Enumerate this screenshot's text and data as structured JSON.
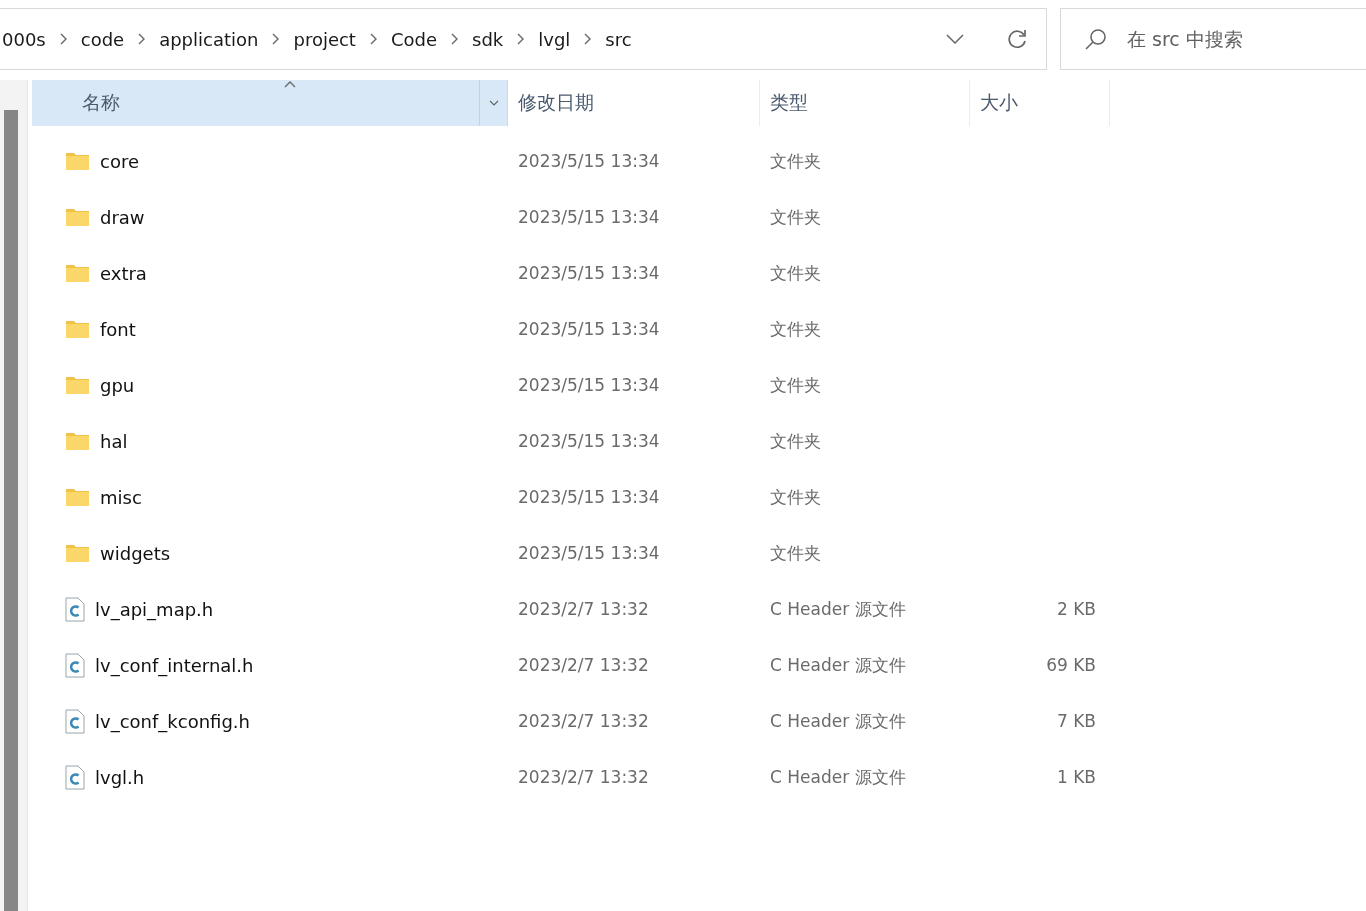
{
  "address_bar": {
    "path": [
      "000s",
      "code",
      "application",
      "project",
      "Code",
      "sdk",
      "lvgl",
      "src"
    ]
  },
  "search": {
    "placeholder": "在 src 中搜索"
  },
  "columns": [
    {
      "label": "名称",
      "selected": true
    },
    {
      "label": "修改日期",
      "selected": false
    },
    {
      "label": "类型",
      "selected": false
    },
    {
      "label": "大小",
      "selected": false
    }
  ],
  "files": [
    {
      "kind": "folder",
      "name": "core",
      "modified": "2023/5/15 13:34",
      "type": "文件夹"
    },
    {
      "kind": "folder",
      "name": "draw",
      "modified": "2023/5/15 13:34",
      "type": "文件夹"
    },
    {
      "kind": "folder",
      "name": "extra",
      "modified": "2023/5/15 13:34",
      "type": "文件夹"
    },
    {
      "kind": "folder",
      "name": "font",
      "modified": "2023/5/15 13:34",
      "type": "文件夹"
    },
    {
      "kind": "folder",
      "name": "gpu",
      "modified": "2023/5/15 13:34",
      "type": "文件夹"
    },
    {
      "kind": "folder",
      "name": "hal",
      "modified": "2023/5/15 13:34",
      "type": "文件夹"
    },
    {
      "kind": "folder",
      "name": "misc",
      "modified": "2023/5/15 13:34",
      "type": "文件夹"
    },
    {
      "kind": "folder",
      "name": "widgets",
      "modified": "2023/5/15 13:34",
      "type": "文件夹"
    },
    {
      "kind": "file",
      "name": "lv_api_map.h",
      "modified": "2023/2/7 13:32",
      "type": "C Header 源文件",
      "size": "2 KB"
    },
    {
      "kind": "file",
      "name": "lv_conf_internal.h",
      "modified": "2023/2/7 13:32",
      "type": "C Header 源文件",
      "size": "69 KB"
    },
    {
      "kind": "file",
      "name": "lv_conf_kconfig.h",
      "modified": "2023/2/7 13:32",
      "type": "C Header 源文件",
      "size": "7 KB"
    },
    {
      "kind": "file",
      "name": "lvgl.h",
      "modified": "2023/2/7 13:32",
      "type": "C Header 源文件",
      "size": "1 KB"
    }
  ]
}
